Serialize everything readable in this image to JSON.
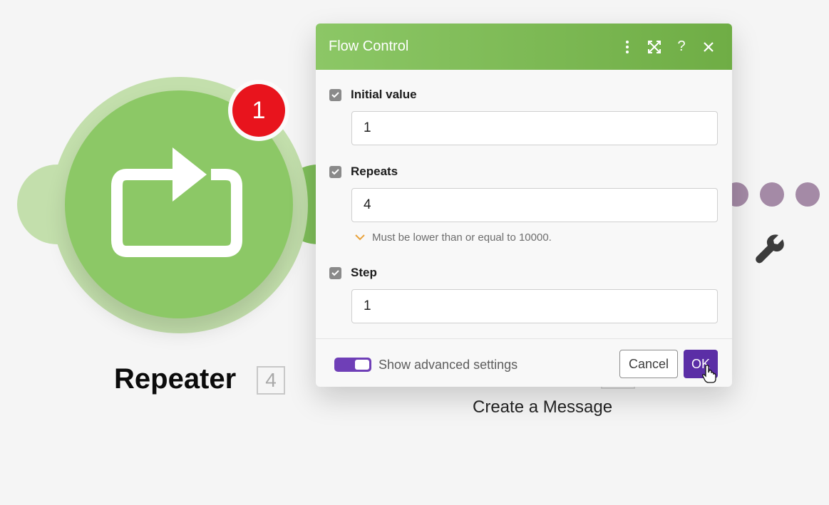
{
  "module": {
    "title": "Repeater",
    "count": "4",
    "badge": "1",
    "icon": "repeat-icon"
  },
  "next_module": {
    "label": "Create a Message",
    "icon": "wrench-icon"
  },
  "dialog": {
    "title": "Flow Control",
    "header_icons": [
      "more-vertical-icon",
      "expand-icon",
      "help-icon",
      "close-icon"
    ],
    "help_label": "?",
    "fields": [
      {
        "label": "Initial value",
        "value": "1"
      },
      {
        "label": "Repeats",
        "value": "4",
        "hint": "Must be lower than or equal to 10000."
      },
      {
        "label": "Step",
        "value": "1"
      }
    ],
    "advanced_toggle_label": "Show advanced settings",
    "advanced_toggle_on": true,
    "cancel_label": "Cancel",
    "ok_label": "OK"
  },
  "colors": {
    "module_green": "#8cc866",
    "badge_red": "#e8141d",
    "header_green": "#7cba55",
    "accent_purple": "#5b2ea6",
    "dot_purple": "#a48aa6"
  }
}
